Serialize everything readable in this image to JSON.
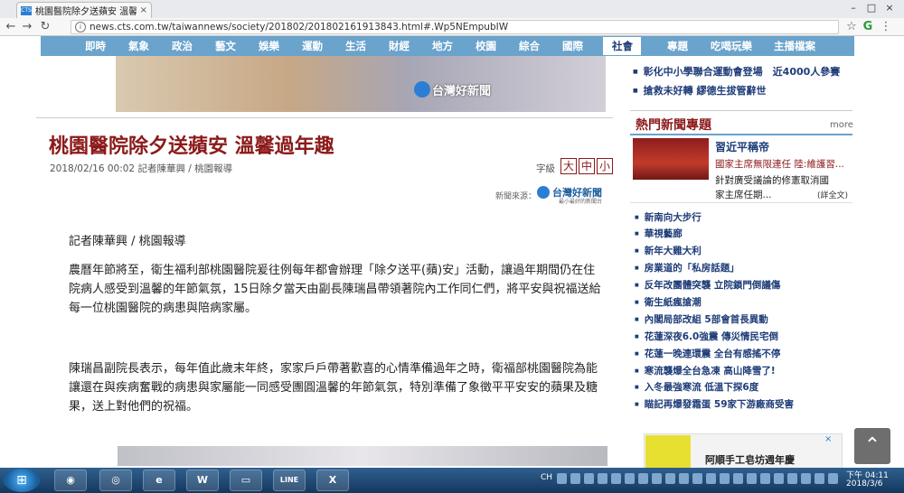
{
  "browser": {
    "tab_title": "桃園醫院除夕送蘋安 溫馨",
    "tab_close": "×",
    "url": "news.cts.com.tw/taiwannews/society/201802/201802161913843.html#.Wp5NEmpubIW",
    "favicon_text": "CTS",
    "window_buttons": [
      "–",
      "□",
      "×"
    ]
  },
  "site_nav": {
    "items": [
      "即時",
      "氣象",
      "政治",
      "藝文",
      "娛樂",
      "運動",
      "生活",
      "財經",
      "地方",
      "校園",
      "綜合",
      "國際",
      "社會",
      "專題",
      "吃喝玩樂",
      "主播檔案"
    ],
    "active": "社會"
  },
  "banner": {
    "logo_text": "台灣好新聞"
  },
  "article": {
    "headline": "桃園醫院除夕送蘋安 溫馨過年趣",
    "meta": "2018/02/16 00:02 記者陳華興 / 桃園報導",
    "font_size_label": "字級",
    "font_sizes": [
      "大",
      "中",
      "小"
    ],
    "source_label": "新聞來源：",
    "source_name": "台灣好新聞",
    "source_sub": "最小最好的新聞台",
    "reporter": "記者陳華興 / 桃園報導",
    "paragraph1": "農曆年節將至，衛生福利部桃園醫院爰往例每年都會辦理「除夕送平(蘋)安」活動，讓過年期間仍在住院病人感受到溫馨的年節氣氛，15日除夕當天由副長陳瑞昌帶領著院內工作同仁們，將平安與祝福送給每一位桃園醫院的病患與陪病家屬。",
    "paragraph2": "陳瑞昌副院長表示，每年值此歲末年終，家家戶戶帶著歡喜的心情準備過年之時，衛福部桃園醫院為能讓還在與疾病奮戰的病患與家屬能一同感受團圓溫馨的年節氣氛，特別準備了象徵平平安安的蘋果及糖果，送上對他們的祝福。"
  },
  "sidebar": {
    "top_items": [
      "彰化中小學聯合運動會登場　近4000人參賽",
      "搶救未好轉 繆德生拔管辭世"
    ],
    "hot_title": "熱門新聞專題",
    "hot_more": "more",
    "hot_headline": "習近平稱帝",
    "hot_lines": [
      "國家主席無限連任 陸:維護習...",
      "針對廣受議論的修憲取消國",
      "家主席任期..."
    ],
    "hot_full": "(詳全文)",
    "items": [
      "新南向大步行",
      "華視藝廊",
      "新年大雞大利",
      "房業道的「私房話題」",
      "反年改團體突襲 立院鎖門倒議傷",
      "衛生紙瘋搶潮",
      "內閣局部改組 5部會首長異動",
      "花蓮深夜6.0強震 傳災情民宅倒",
      "花蓮一晚連環震 全台有感搖不停",
      "寒流襲爆全台急凍 高山降雪了!",
      "入冬最強寒流 低溫下探6度",
      "瞄記再爆發霜蛋 59家下游廠商受害"
    ],
    "ad_text": "阿順手工皂坊週年慶",
    "ad_close": "×",
    "scroll_top": "⌃"
  },
  "taskbar": {
    "start": "⊞",
    "apps": [
      "◉",
      "◎",
      "e",
      "W",
      "▭",
      "LINE",
      "X"
    ],
    "lang": "CH",
    "time": "下午 04:11",
    "date": "2018/3/6"
  }
}
